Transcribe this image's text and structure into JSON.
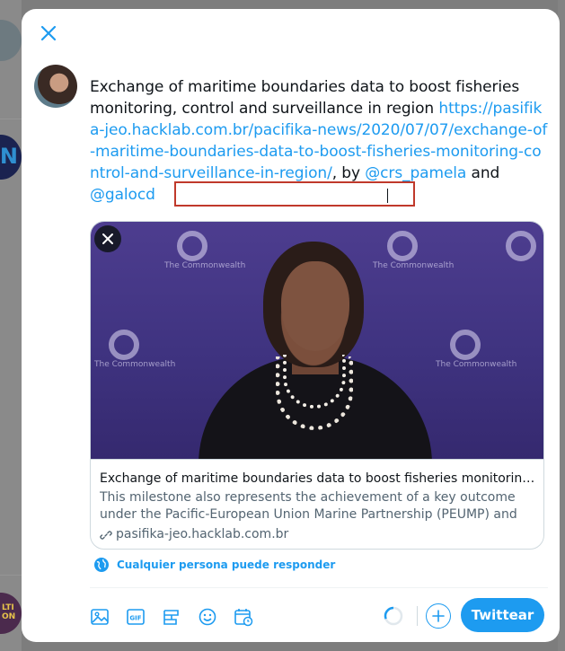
{
  "compose": {
    "text_main": "Exchange of maritime boundaries data to boost fisheries monitoring, control and surveillance in region",
    "link": "https://pasifika-jeo.hacklab.com.br/pacifika-news/2020/07/07/exchange-of-maritime-boundaries-data-to-boost-fisheries-monitoring-control-and-surveillance-in-region/",
    "by_text": ", by ",
    "mention_1": "@crs_pamela",
    "and_text": " and ",
    "mention_2": "@galocd"
  },
  "card": {
    "title": "Exchange of maritime boundaries data to boost fisheries monitoring, control and surveillance in region",
    "description": "This milestone also represents the achievement of a key outcome under the Pacific-European Union Marine Partnership (PEUMP) and the Pacific Ocean Commissioner",
    "domain": "pasifika-jeo.hacklab.com.br",
    "image_logo_text": "The Commonwealth"
  },
  "reply_setting": {
    "label": "Cualquier persona puede responder"
  },
  "toolbar": {
    "icons": [
      "image-icon",
      "gif-icon",
      "poll-icon",
      "emoji-icon",
      "schedule-icon"
    ],
    "tweet_label": "Twittear"
  },
  "colors": {
    "accent": "#1d9bf0",
    "highlight_border": "#c0392b",
    "text": "#0f1419",
    "muted": "#536471",
    "image_bg": "#4d3d8f"
  }
}
